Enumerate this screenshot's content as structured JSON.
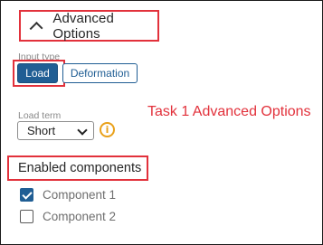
{
  "advanced": {
    "title": "Advanced Options"
  },
  "input_type": {
    "label": "Input type",
    "options": [
      "Load",
      "Deformation"
    ],
    "selected": "Load"
  },
  "load_term": {
    "label": "Load term",
    "value": "Short"
  },
  "annotation": {
    "text": "Task 1 Advanced Options"
  },
  "components": {
    "title": "Enabled components",
    "items": [
      {
        "label": "Component 1",
        "checked": true
      },
      {
        "label": "Component 2",
        "checked": false
      }
    ]
  },
  "colors": {
    "accent": "#205e94",
    "highlight": "#e2313b",
    "info": "#e9a11a"
  },
  "icons": {
    "collapse": "chevron-up-icon",
    "dropdown": "chevron-down-icon",
    "info": "info-icon"
  }
}
